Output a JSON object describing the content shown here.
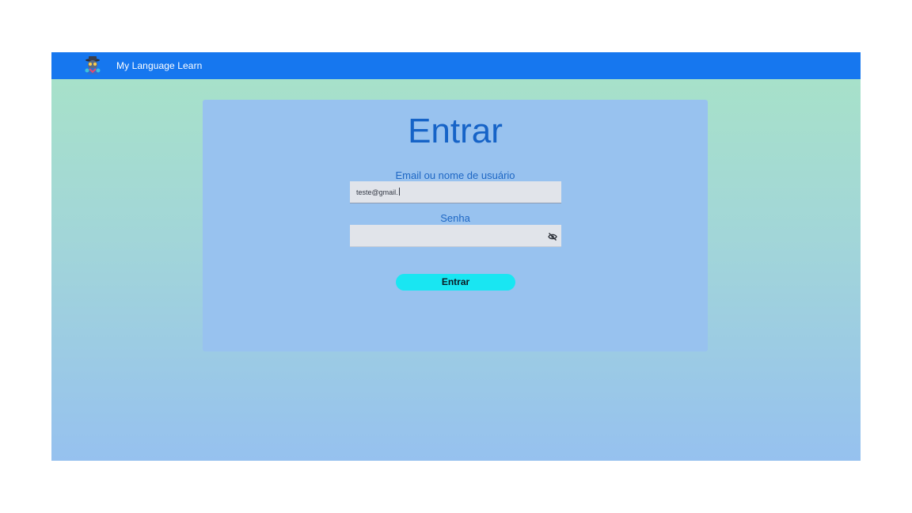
{
  "app": {
    "title": "My Language Learn",
    "logo_icon": "detective-mascot-icon",
    "colors": {
      "appbar": "#1677ef",
      "card": "#98c2ef",
      "title": "#1663c7",
      "button": "#19e6f2"
    }
  },
  "login": {
    "heading": "Entrar",
    "email_label": "Email ou nome de usuário",
    "email_value": "teste@gmail.",
    "password_label": "Senha",
    "password_value": "",
    "visibility_icon": "eye-off-icon",
    "submit_label": "Entrar"
  }
}
